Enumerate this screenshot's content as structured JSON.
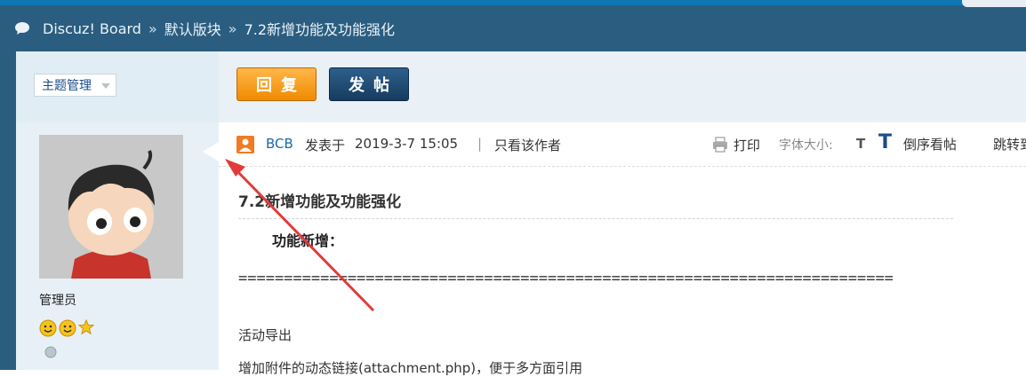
{
  "breadcrumb": {
    "site": "Discuz! Board",
    "sep1": "»",
    "forum": "默认版块",
    "sep2": "»",
    "thread": "7.2新增功能及功能强化"
  },
  "sidebar": {
    "manage_label": "主题管理",
    "role": "管理员"
  },
  "actions": {
    "reply_label": "回复",
    "post_label": "发帖"
  },
  "post_header": {
    "author": "BCB",
    "posted_label": "发表于",
    "posted_time": "2019-3-7 15:05",
    "pipe": "|",
    "only_author": "只看该作者",
    "print": "打印",
    "font_size_label": "字体大小:",
    "small_t": "T",
    "big_t": "T",
    "reverse": "倒序看帖",
    "jump": "跳转到"
  },
  "post": {
    "title": "7.2新增功能及功能强化",
    "section_head": "功能新增：",
    "divider": "========================================================================",
    "item1": "活动导出",
    "item2": "增加附件的动态链接(attachment.php)，便于多方面引用"
  },
  "colors": {
    "topbar": "#2b5d80",
    "reply_button": "#f08a00",
    "post_button": "#173c5e",
    "author_link": "#1b69a8",
    "annotation_arrow": "#e23b3b"
  }
}
